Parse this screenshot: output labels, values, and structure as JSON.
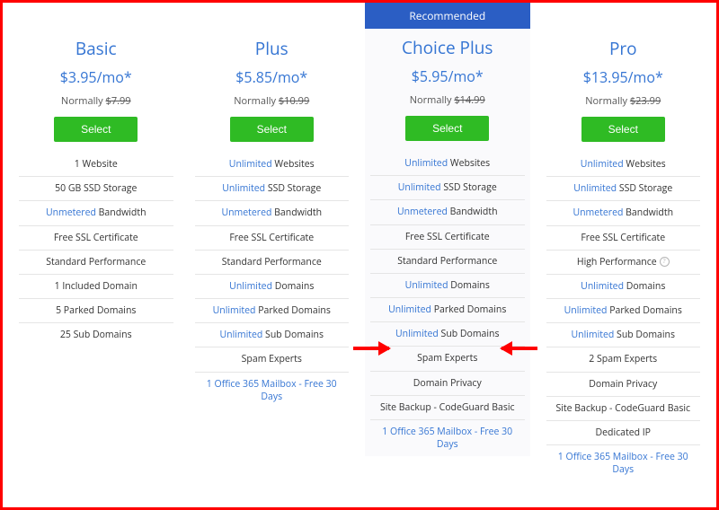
{
  "badge_recommended": "Recommended",
  "normally_label": "Normally",
  "select_label": "Select",
  "plans": [
    {
      "name": "Basic",
      "price": "$3.95/mo*",
      "normal_price": "$7.99",
      "recommended": false,
      "features": [
        {
          "text": "1 Website"
        },
        {
          "text": "50 GB SSD Storage"
        },
        {
          "hl": "Unmetered",
          "rest": " Bandwidth"
        },
        {
          "text": "Free SSL Certificate"
        },
        {
          "text": "Standard Performance"
        },
        {
          "text": "1 Included Domain"
        },
        {
          "text": "5 Parked Domains"
        },
        {
          "text": "25 Sub Domains"
        }
      ]
    },
    {
      "name": "Plus",
      "price": "$5.85/mo*",
      "normal_price": "$10.99",
      "recommended": false,
      "features": [
        {
          "hl": "Unlimited",
          "rest": " Websites"
        },
        {
          "hl": "Unlimited",
          "rest": " SSD Storage"
        },
        {
          "hl": "Unmetered",
          "rest": " Bandwidth"
        },
        {
          "text": "Free SSL Certificate"
        },
        {
          "text": "Standard Performance"
        },
        {
          "hl": "Unlimited",
          "rest": " Domains"
        },
        {
          "hl": "Unlimited",
          "rest": " Parked Domains"
        },
        {
          "hl": "Unlimited",
          "rest": " Sub Domains"
        },
        {
          "text": "Spam Experts"
        },
        {
          "full_hl": "1 Office 365 Mailbox - Free 30 Days"
        }
      ]
    },
    {
      "name": "Choice Plus",
      "price": "$5.95/mo*",
      "normal_price": "$14.99",
      "recommended": true,
      "features": [
        {
          "hl": "Unlimited",
          "rest": " Websites"
        },
        {
          "hl": "Unlimited",
          "rest": " SSD Storage"
        },
        {
          "hl": "Unmetered",
          "rest": " Bandwidth"
        },
        {
          "text": "Free SSL Certificate"
        },
        {
          "text": "Standard Performance"
        },
        {
          "hl": "Unlimited",
          "rest": " Domains"
        },
        {
          "hl": "Unlimited",
          "rest": " Parked Domains"
        },
        {
          "hl": "Unlimited",
          "rest": " Sub Domains"
        },
        {
          "text": "Spam Experts"
        },
        {
          "text": "Domain Privacy"
        },
        {
          "text": "Site Backup - CodeGuard Basic"
        },
        {
          "full_hl": "1 Office 365 Mailbox - Free 30 Days"
        }
      ]
    },
    {
      "name": "Pro",
      "price": "$13.95/mo*",
      "normal_price": "$23.99",
      "recommended": false,
      "features": [
        {
          "hl": "Unlimited",
          "rest": " Websites"
        },
        {
          "hl": "Unlimited",
          "rest": " SSD Storage"
        },
        {
          "hl": "Unmetered",
          "rest": " Bandwidth"
        },
        {
          "text": "Free SSL Certificate"
        },
        {
          "text": "High Performance",
          "info": true
        },
        {
          "hl": "Unlimited",
          "rest": " Domains"
        },
        {
          "hl": "Unlimited",
          "rest": " Parked Domains"
        },
        {
          "hl": "Unlimited",
          "rest": " Sub Domains"
        },
        {
          "text": "2 Spam Experts"
        },
        {
          "text": "Domain Privacy"
        },
        {
          "text": "Site Backup - CodeGuard Basic"
        },
        {
          "text": "Dedicated IP"
        },
        {
          "full_hl": "1 Office 365 Mailbox - Free 30 Days"
        }
      ]
    }
  ]
}
